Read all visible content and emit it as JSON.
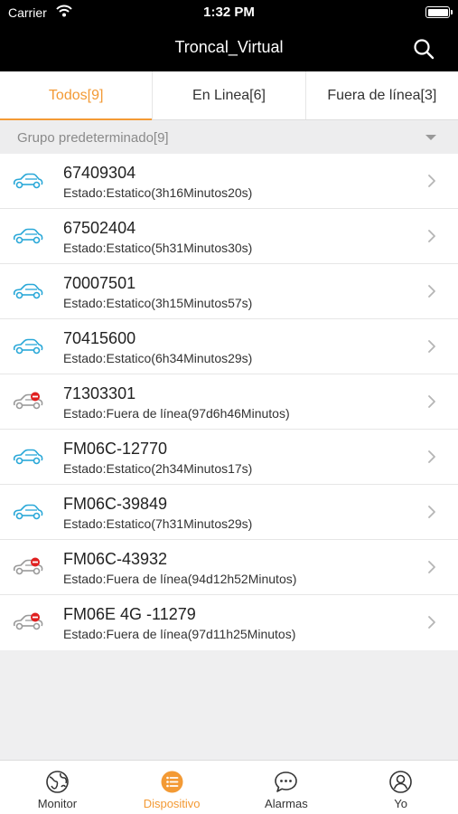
{
  "status_bar": {
    "carrier": "Carrier",
    "time": "1:32 PM"
  },
  "nav": {
    "title": "Troncal_Virtual",
    "search_icon": "search-icon"
  },
  "tabs": [
    {
      "label": "Todos[9]",
      "active": true
    },
    {
      "label": "En Linea[6]",
      "active": false
    },
    {
      "label": "Fuera de línea[3]",
      "active": false
    }
  ],
  "group": {
    "label": "Grupo predeterminado[9]"
  },
  "devices": [
    {
      "name": "67409304",
      "status": "Estado:Estatico(3h16Minutos20s)",
      "online": true
    },
    {
      "name": "67502404",
      "status": "Estado:Estatico(5h31Minutos30s)",
      "online": true
    },
    {
      "name": "70007501",
      "status": "Estado:Estatico(3h15Minutos57s)",
      "online": true
    },
    {
      "name": "70415600",
      "status": "Estado:Estatico(6h34Minutos29s)",
      "online": true
    },
    {
      "name": "71303301",
      "status": "Estado:Fuera de línea(97d6h46Minutos)",
      "online": false
    },
    {
      "name": "FM06C-12770",
      "status": "Estado:Estatico(2h34Minutos17s)",
      "online": true
    },
    {
      "name": "FM06C-39849",
      "status": "Estado:Estatico(7h31Minutos29s)",
      "online": true
    },
    {
      "name": "FM06C-43932",
      "status": "Estado:Fuera de línea(94d12h52Minutos)",
      "online": false
    },
    {
      "name": "FM06E 4G -11279",
      "status": "Estado:Fuera de línea(97d11h25Minutos)",
      "online": false
    }
  ],
  "tab_bar": [
    {
      "label": "Monitor",
      "icon": "globe-icon",
      "active": false
    },
    {
      "label": "Dispositivo",
      "icon": "list-icon",
      "active": true
    },
    {
      "label": "Alarmas",
      "icon": "chat-bubble-icon",
      "active": false
    },
    {
      "label": "Yo",
      "icon": "user-icon",
      "active": false
    }
  ],
  "colors": {
    "accent": "#f39a35",
    "online_car": "#2aa8d8",
    "offline_car": "#9a9a9a",
    "offline_badge": "#e02020"
  }
}
